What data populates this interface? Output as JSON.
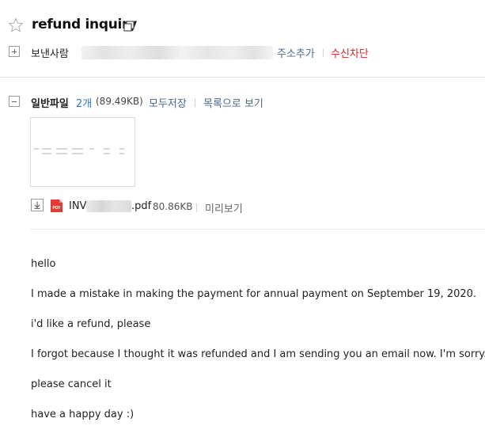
{
  "header": {
    "subject": "refund inquiry",
    "sender_label": "보낸사람",
    "add_address_label": "주소추가",
    "block_label": "수신차단"
  },
  "attachments": {
    "title": "일반파일",
    "count": "2개",
    "total_size": "(89.49KB)",
    "save_all_label": "모두저장",
    "list_view_label": "목록으로 보기",
    "file": {
      "name_prefix": "INV",
      "extension": ".pdf",
      "size": "80.86KB",
      "preview_label": "미리보기",
      "icon_text": "PDF"
    }
  },
  "body": {
    "lines": [
      "hello",
      "I made a mistake in making the payment for annual payment on September 19, 2020.",
      "i'd like a refund, please",
      "I forgot because I thought it was refunded and I am sending you an email now. I'm sorry.",
      "please cancel it",
      "have a happy day :)"
    ]
  },
  "colors": {
    "link": "#4a6a8a",
    "block": "#d3272b",
    "count": "#2a7ad3",
    "pdf": "#e33b34"
  },
  "icons": {
    "star": "star-outline-icon",
    "copy": "copy-icon",
    "expand": "plus-box-icon",
    "collapse": "minus-box-icon",
    "download": "download-icon",
    "pdf": "pdf-file-icon"
  }
}
